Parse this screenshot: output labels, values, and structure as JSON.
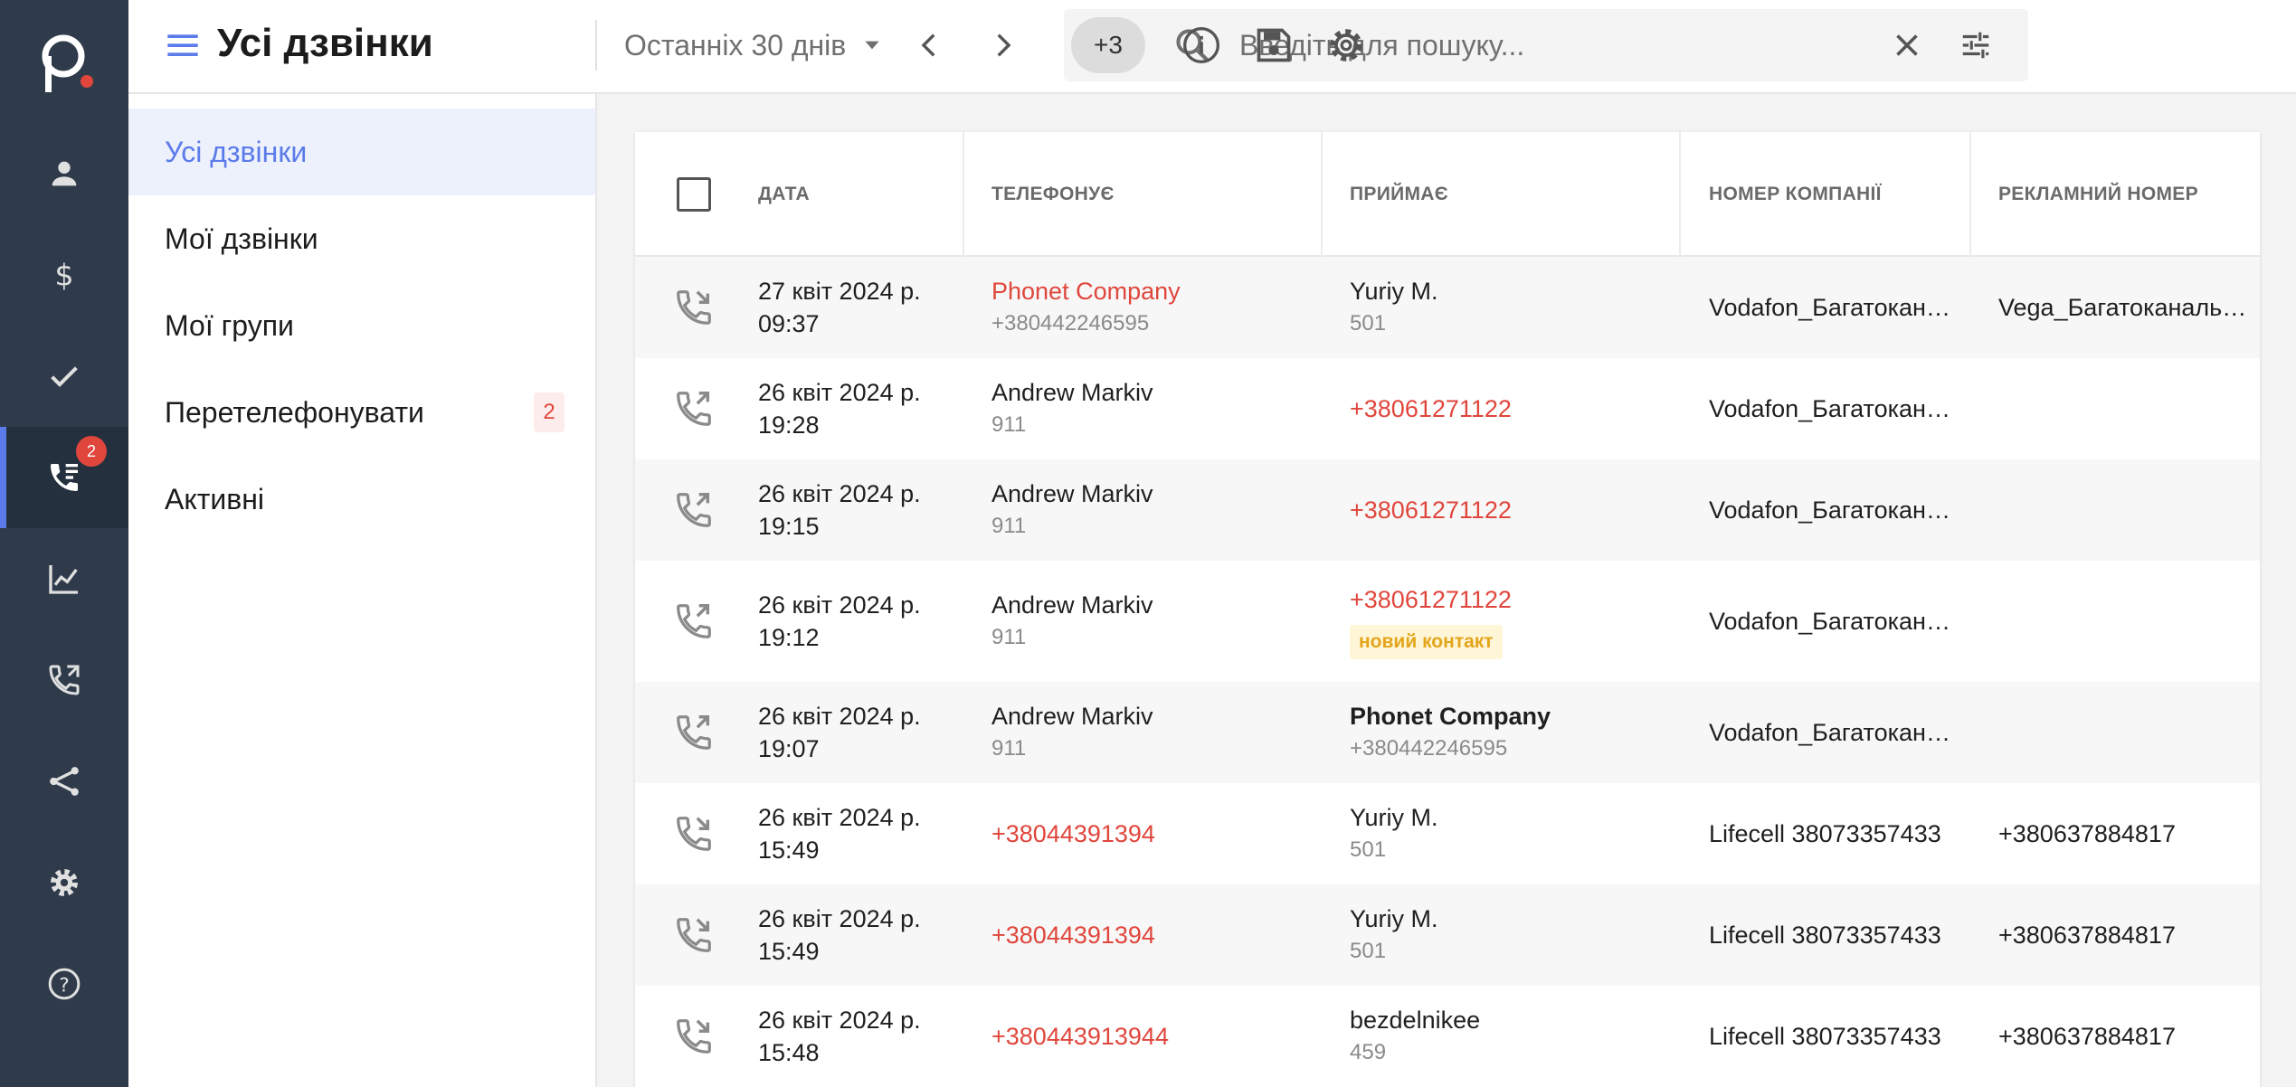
{
  "rail": {
    "calls_badge": "2"
  },
  "header": {
    "title": "Усі дзвінки",
    "period": "Останніх 30 днів",
    "chip": "+3",
    "search_placeholder": "Введіть для пошуку..."
  },
  "subnav": {
    "items": [
      {
        "label": "Усі дзвінки"
      },
      {
        "label": "Мої дзвінки"
      },
      {
        "label": "Мої групи"
      },
      {
        "label": "Перетелефонувати",
        "count": "2"
      },
      {
        "label": "Активні"
      }
    ]
  },
  "table": {
    "columns": [
      "ДАТА",
      "ТЕЛЕФОНУЄ",
      "ПРИЙМАЄ",
      "НОМЕР КОМПАНІЇ",
      "РЕКЛАМНИЙ НОМЕР"
    ],
    "rows": [
      {
        "direction": "incoming",
        "date": "27 квіт 2024 р.",
        "time": "09:37",
        "caller": "Phonet Company",
        "caller_sub": "+380442246595",
        "receiver": "Yuriy M.",
        "receiver_sub": "501",
        "company": "Vodafon_Багатокан…",
        "ad": "Vega_Багатоканаль…"
      },
      {
        "direction": "outgoing",
        "date": "26 квіт 2024 р.",
        "time": "19:28",
        "caller": "Andrew Markiv",
        "caller_sub": "911",
        "receiver": "+38061271122",
        "receiver_sub": "",
        "company": "Vodafon_Багатокан…",
        "ad": ""
      },
      {
        "direction": "outgoing",
        "date": "26 квіт 2024 р.",
        "time": "19:15",
        "caller": "Andrew Markiv",
        "caller_sub": "911",
        "receiver": "+38061271122",
        "receiver_sub": "",
        "company": "Vodafon_Багатокан…",
        "ad": ""
      },
      {
        "direction": "outgoing",
        "date": "26 квіт 2024 р.",
        "time": "19:12",
        "caller": "Andrew Markiv",
        "caller_sub": "911",
        "receiver": "+38061271122",
        "receiver_tag": "новий контакт",
        "company": "Vodafon_Багатокан…",
        "ad": ""
      },
      {
        "direction": "outgoing",
        "date": "26 квіт 2024 р.",
        "time": "19:07",
        "caller": "Andrew Markiv",
        "caller_sub": "911",
        "receiver": "Phonet Company",
        "receiver_sub": "+380442246595",
        "company": "Vodafon_Багатокан…",
        "ad": ""
      },
      {
        "direction": "incoming",
        "date": "26 квіт 2024 р.",
        "time": "15:49",
        "caller": "+38044391394",
        "caller_sub": "",
        "receiver": "Yuriy M.",
        "receiver_sub": "501",
        "company": "Lifecell 38073357433",
        "ad": "+380637884817"
      },
      {
        "direction": "incoming",
        "date": "26 квіт 2024 р.",
        "time": "15:49",
        "caller": "+38044391394",
        "caller_sub": "",
        "receiver": "Yuriy M.",
        "receiver_sub": "501",
        "company": "Lifecell 38073357433",
        "ad": "+380637884817"
      },
      {
        "direction": "incoming",
        "date": "26 квіт 2024 р.",
        "time": "15:48",
        "caller": "+380443913944",
        "caller_sub": "",
        "receiver": "bezdelnikee",
        "receiver_sub": "459",
        "company": "Lifecell 38073357433",
        "ad": "+380637884817"
      }
    ]
  },
  "colors": {
    "rail_bg": "#2f3b4b",
    "accent": "#5b7bea",
    "alert": "#e0463c",
    "new_contact": "#e3a51a"
  }
}
